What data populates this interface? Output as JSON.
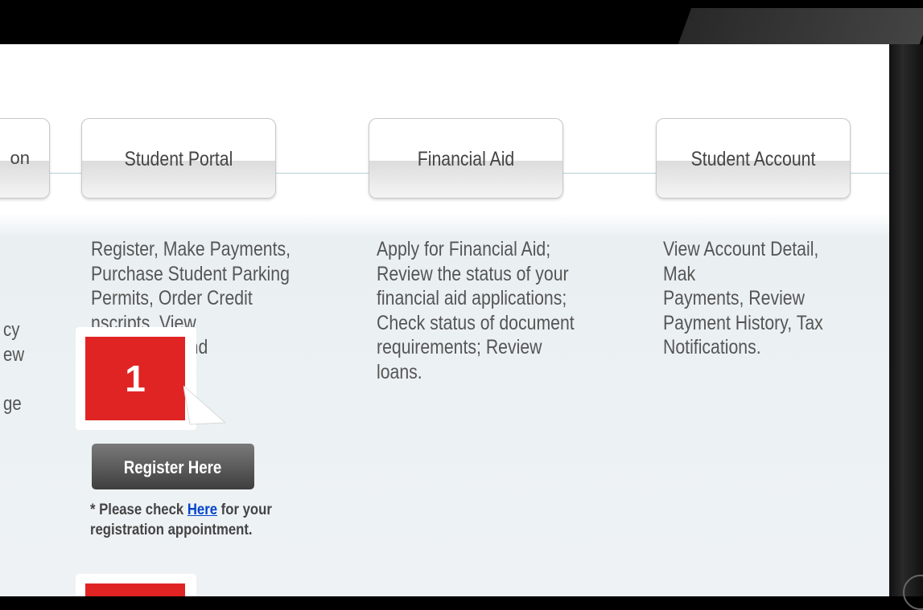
{
  "tabs": [
    {
      "label": "on"
    },
    {
      "label": "Student Portal"
    },
    {
      "label": "Financial Aid"
    },
    {
      "label": "Student Account"
    }
  ],
  "descriptions": {
    "left": "cy\new\n\nge",
    "student_portal": "Register, Make Payments,\nPurchase Student Parking\nPermits, Order Credit\n          nscripts, View\n          nic records and",
    "financial_aid": "Apply for Financial Aid;\nReview the status of your\nfinancial aid applications;\nCheck status of document\nrequirements; Review\nloans.",
    "student_account": "View Account Detail, Mak\nPayments, Review\nPayment History, Tax\nNotifications."
  },
  "register_button": {
    "label": "Register Here"
  },
  "note": {
    "prefix": "* Please check ",
    "link": "Here",
    "suffix": " for your",
    "line2": "registration appointment."
  },
  "callouts": [
    {
      "number": "1"
    },
    {
      "number": ""
    }
  ],
  "colors": {
    "callout_red": "#e02424",
    "link_blue": "#0044cc",
    "button_dark": "#4a4a4a"
  }
}
